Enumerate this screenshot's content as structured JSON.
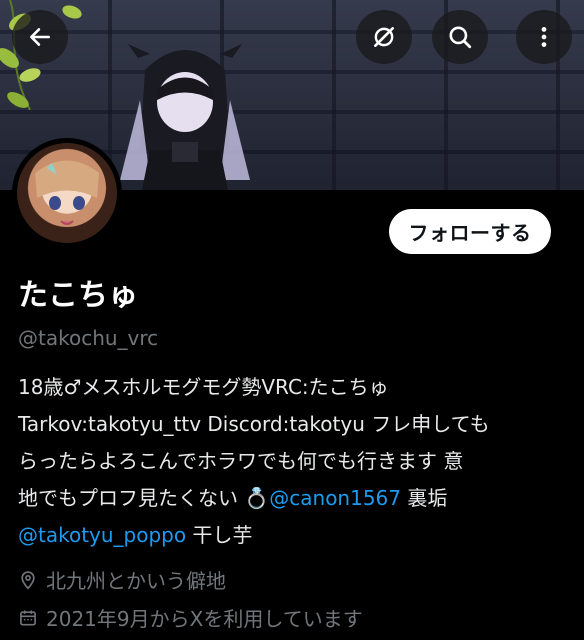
{
  "header": {
    "back_icon": "arrow-left-icon",
    "grok_icon": "grok-icon",
    "search_icon": "search-icon",
    "more_icon": "more-vertical-icon"
  },
  "profile": {
    "follow_label": "フォローする",
    "display_name": "たこちゅ",
    "handle": "@takochu_vrc",
    "bio": {
      "line1": "18歳♂メスホルモグモグ勢VRC:たこちゅ",
      "line2": "Tarkov:takotyu_ttv Discord:takotyu フレ申しても",
      "line3": "らったらよろこんでホラワでも何でも行きます 意",
      "line4_prefix": "地でもプロフ見たくない 💍",
      "line4_mention": "@canon1567",
      "line4_suffix": " 裏垢",
      "line5_mention": "@takotyu_poppo",
      "line5_suffix": " 干し芋"
    },
    "location": "北九州とかいう僻地",
    "joined": "2021年9月からXを利用しています"
  },
  "colors": {
    "background": "#000000",
    "text": "#e7e9ea",
    "muted": "#71767b",
    "link": "#1d9bf0",
    "button_bg": "#ffffff"
  }
}
